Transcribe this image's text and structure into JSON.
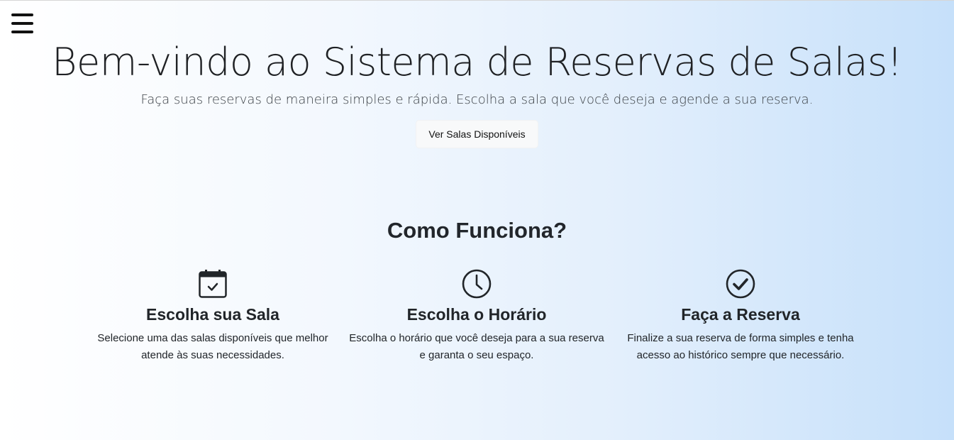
{
  "menu": {
    "icon": "hamburger-icon"
  },
  "hero": {
    "title": "Bem-vindo ao Sistema de Reservas de Salas!",
    "subtitle": "Faça suas reservas de maneira simples e rápida. Escolha a sala que você deseja e agende a sua reserva.",
    "button_label": "Ver Salas Disponíveis"
  },
  "how": {
    "title": "Como Funciona?",
    "steps": [
      {
        "icon": "calendar-check-icon",
        "title": "Escolha sua Sala",
        "text": "Selecione uma das salas disponíveis que melhor atende às suas necessidades."
      },
      {
        "icon": "clock-icon",
        "title": "Escolha o Horário",
        "text": "Escolha o horário que você deseja para a sua reserva e garanta o seu espaço."
      },
      {
        "icon": "check-circle-icon",
        "title": "Faça a Reserva",
        "text": "Finalize a sua reserva de forma simples e tenha acesso ao histórico sempre que necessário."
      }
    ]
  }
}
